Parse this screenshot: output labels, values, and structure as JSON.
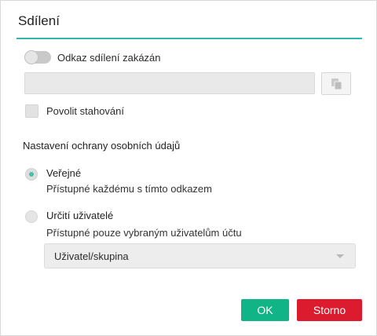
{
  "dialog": {
    "title": "Sdílení",
    "accent_color": "#2fb7b0"
  },
  "share_link": {
    "toggle_label": "Odkaz sdílení zakázán",
    "toggle_on": false,
    "link_value": "",
    "copy_icon": "copy-icon"
  },
  "download": {
    "label": "Povolit stahování",
    "checked": false
  },
  "privacy": {
    "section_title": "Nastavení ochrany osobních údajů",
    "options": [
      {
        "label": "Veřejné",
        "description": "Přístupné každému s tímto odkazem",
        "selected": true
      },
      {
        "label": "Určití uživatelé",
        "description": "Přístupné pouze vybraným uživatelům účtu",
        "selected": false
      }
    ],
    "user_group_select": {
      "value": "Uživatel/skupina"
    }
  },
  "buttons": {
    "ok_label": "OK",
    "ok_color": "#11b486",
    "cancel_label": "Storno",
    "cancel_color": "#dc1c2e"
  }
}
